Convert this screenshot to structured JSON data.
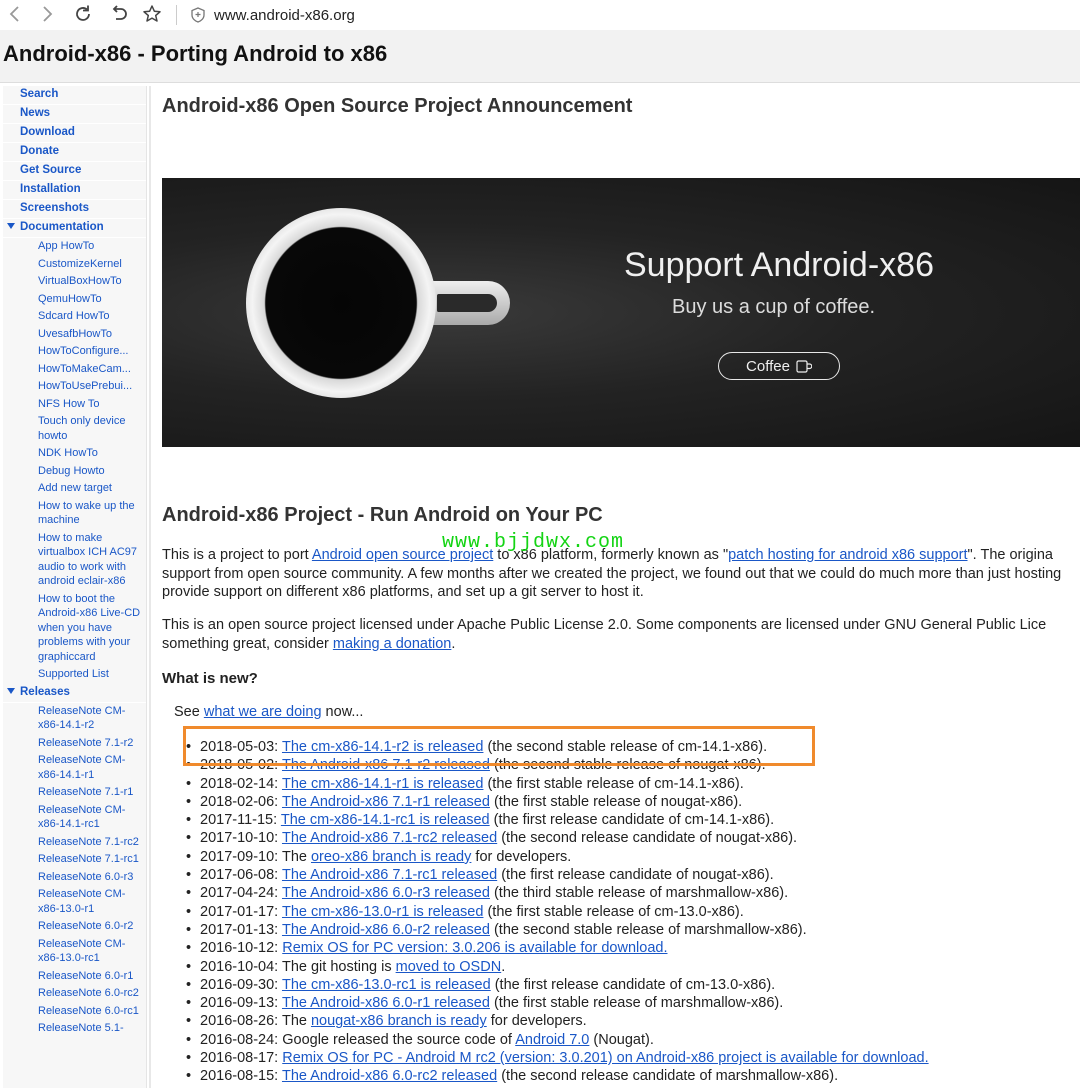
{
  "browser": {
    "url": "www.android-x86.org"
  },
  "site": {
    "title": "Android-x86 - Porting Android to x86"
  },
  "sidebar": {
    "top_items": [
      "Search",
      "News",
      "Download",
      "Donate",
      "Get Source",
      "Installation",
      "Screenshots"
    ],
    "documentation": {
      "label": "Documentation",
      "items": [
        "App HowTo",
        "CustomizeKernel",
        "VirtualBoxHowTo",
        "QemuHowTo",
        "Sdcard HowTo",
        "UvesafbHowTo",
        "HowToConfigure...",
        "HowToMakeCam...",
        "HowToUsePrebui...",
        "NFS How To",
        "Touch only device howto",
        "NDK HowTo",
        "Debug Howto",
        "Add new target",
        "How to wake up the machine",
        "How to make virtualbox ICH AC97 audio to work with android eclair-x86",
        "How to boot the Android-x86 Live-CD when you have problems with your graphiccard",
        "Supported List"
      ]
    },
    "releases": {
      "label": "Releases",
      "items": [
        "ReleaseNote CM-x86-14.1-r2",
        "ReleaseNote 7.1-r2",
        "ReleaseNote CM-x86-14.1-r1",
        "ReleaseNote 7.1-r1",
        "ReleaseNote CM-x86-14.1-rc1",
        "ReleaseNote 7.1-rc2",
        "ReleaseNote 7.1-rc1",
        "ReleaseNote 6.0-r3",
        "ReleaseNote CM-x86-13.0-r1",
        "ReleaseNote 6.0-r2",
        "ReleaseNote CM-x86-13.0-rc1",
        "ReleaseNote 6.0-r1",
        "ReleaseNote 6.0-rc2",
        "ReleaseNote 6.0-rc1",
        "ReleaseNote 5.1-"
      ]
    }
  },
  "main": {
    "announcement_heading": "Android-x86 Open Source Project Announcement",
    "promo": {
      "title": "Support Android-x86",
      "subtitle": "Buy us a cup of coffee.",
      "button": "Coffee"
    },
    "project_heading": "Android-x86 Project - Run Android on Your PC",
    "watermark": "www.bjjdwx.com",
    "para1": {
      "l1_a": "This is a project to port ",
      "l1_link1": "Android open source project",
      "l1_b": " to x86 platform, formerly known as \"",
      "l1_link2": "patch hosting for android x86 support",
      "l1_c": "\". The origina",
      "l2": "support from open source community. A few months after we created the project, we found out that we could do much more than just hosting",
      "l3": "provide support on different x86 platforms, and set up a git server to host it."
    },
    "para2": {
      "l1": "This is an open source project licensed under Apache Public License 2.0. Some components are licensed under GNU General Public Lice",
      "l2_a": "something great, consider ",
      "l2_link": "making a donation",
      "l2_b": "."
    },
    "whats_new": "What is new?",
    "see": {
      "a": "See ",
      "link": "what we are doing",
      "b": " now..."
    },
    "news": [
      {
        "date": "2018-05-03: ",
        "link": "The cm-x86-14.1-r2 is released",
        "text": " (the second stable release of cm-14.1-x86)."
      },
      {
        "date": "2018-05-02: ",
        "link": "The Android-x86 7.1-r2 released",
        "text": " (the second stable release of nougat-x86)."
      },
      {
        "date": "2018-02-14: ",
        "link": "The cm-x86-14.1-r1 is released",
        "text": " (the first stable release of cm-14.1-x86)."
      },
      {
        "date": "2018-02-06: ",
        "link": "The Android-x86 7.1-r1 released",
        "text": " (the first stable release of nougat-x86)."
      },
      {
        "date": "2017-11-15: ",
        "link": "The cm-x86-14.1-rc1 is released",
        "text": " (the first release candidate of cm-14.1-x86)."
      },
      {
        "date": "2017-10-10: ",
        "link": "The Android-x86 7.1-rc2 released",
        "text": " (the second release candidate of nougat-x86)."
      },
      {
        "date": "2017-09-10: The ",
        "link": "oreo-x86 branch is ready",
        "text": " for developers."
      },
      {
        "date": "2017-06-08: ",
        "link": "The Android-x86 7.1-rc1 released",
        "text": " (the first release candidate of nougat-x86)."
      },
      {
        "date": "2017-04-24: ",
        "link": "The Android-x86 6.0-r3 released",
        "text": " (the third stable release of marshmallow-x86)."
      },
      {
        "date": "2017-01-17: ",
        "link": "The cm-x86-13.0-r1 is released",
        "text": " (the first stable release of cm-13.0-x86)."
      },
      {
        "date": "2017-01-13: ",
        "link": "The Android-x86 6.0-r2 released",
        "text": " (the second stable release of marshmallow-x86)."
      },
      {
        "date": "2016-10-12: ",
        "link": "Remix OS for PC version: 3.0.206 is available for download.",
        "text": ""
      },
      {
        "date": "2016-10-04: The git hosting is ",
        "link": "moved to OSDN",
        "text": "."
      },
      {
        "date": "2016-09-30: ",
        "link": "The cm-x86-13.0-rc1 is released",
        "text": " (the first release candidate of cm-13.0-x86)."
      },
      {
        "date": "2016-09-13: ",
        "link": "The Android-x86 6.0-r1 released",
        "text": " (the first stable release of marshmallow-x86)."
      },
      {
        "date": "2016-08-26: The ",
        "link": "nougat-x86 branch is ready",
        "text": " for developers."
      },
      {
        "date": "2016-08-24: Google released the source code of ",
        "link": "Android 7.0",
        "text": " (Nougat)."
      },
      {
        "date": "2016-08-17: ",
        "link": "Remix OS for PC - Android M rc2 (version: 3.0.201) on Android-x86 project is available for download.",
        "text": ""
      },
      {
        "date": "2016-08-15: ",
        "link": "The Android-x86 6.0-rc2 released",
        "text": " (the second release candidate of marshmallow-x86)."
      }
    ]
  },
  "colors": {
    "link": "#1a57c7",
    "highlight_box": "#f08a2c",
    "watermark": "#14d414"
  },
  "icons": [
    "back-icon",
    "forward-icon",
    "reload-icon",
    "undo-icon",
    "star-icon",
    "shield-icon",
    "caret-down-icon",
    "coffee-cup-icon"
  ]
}
